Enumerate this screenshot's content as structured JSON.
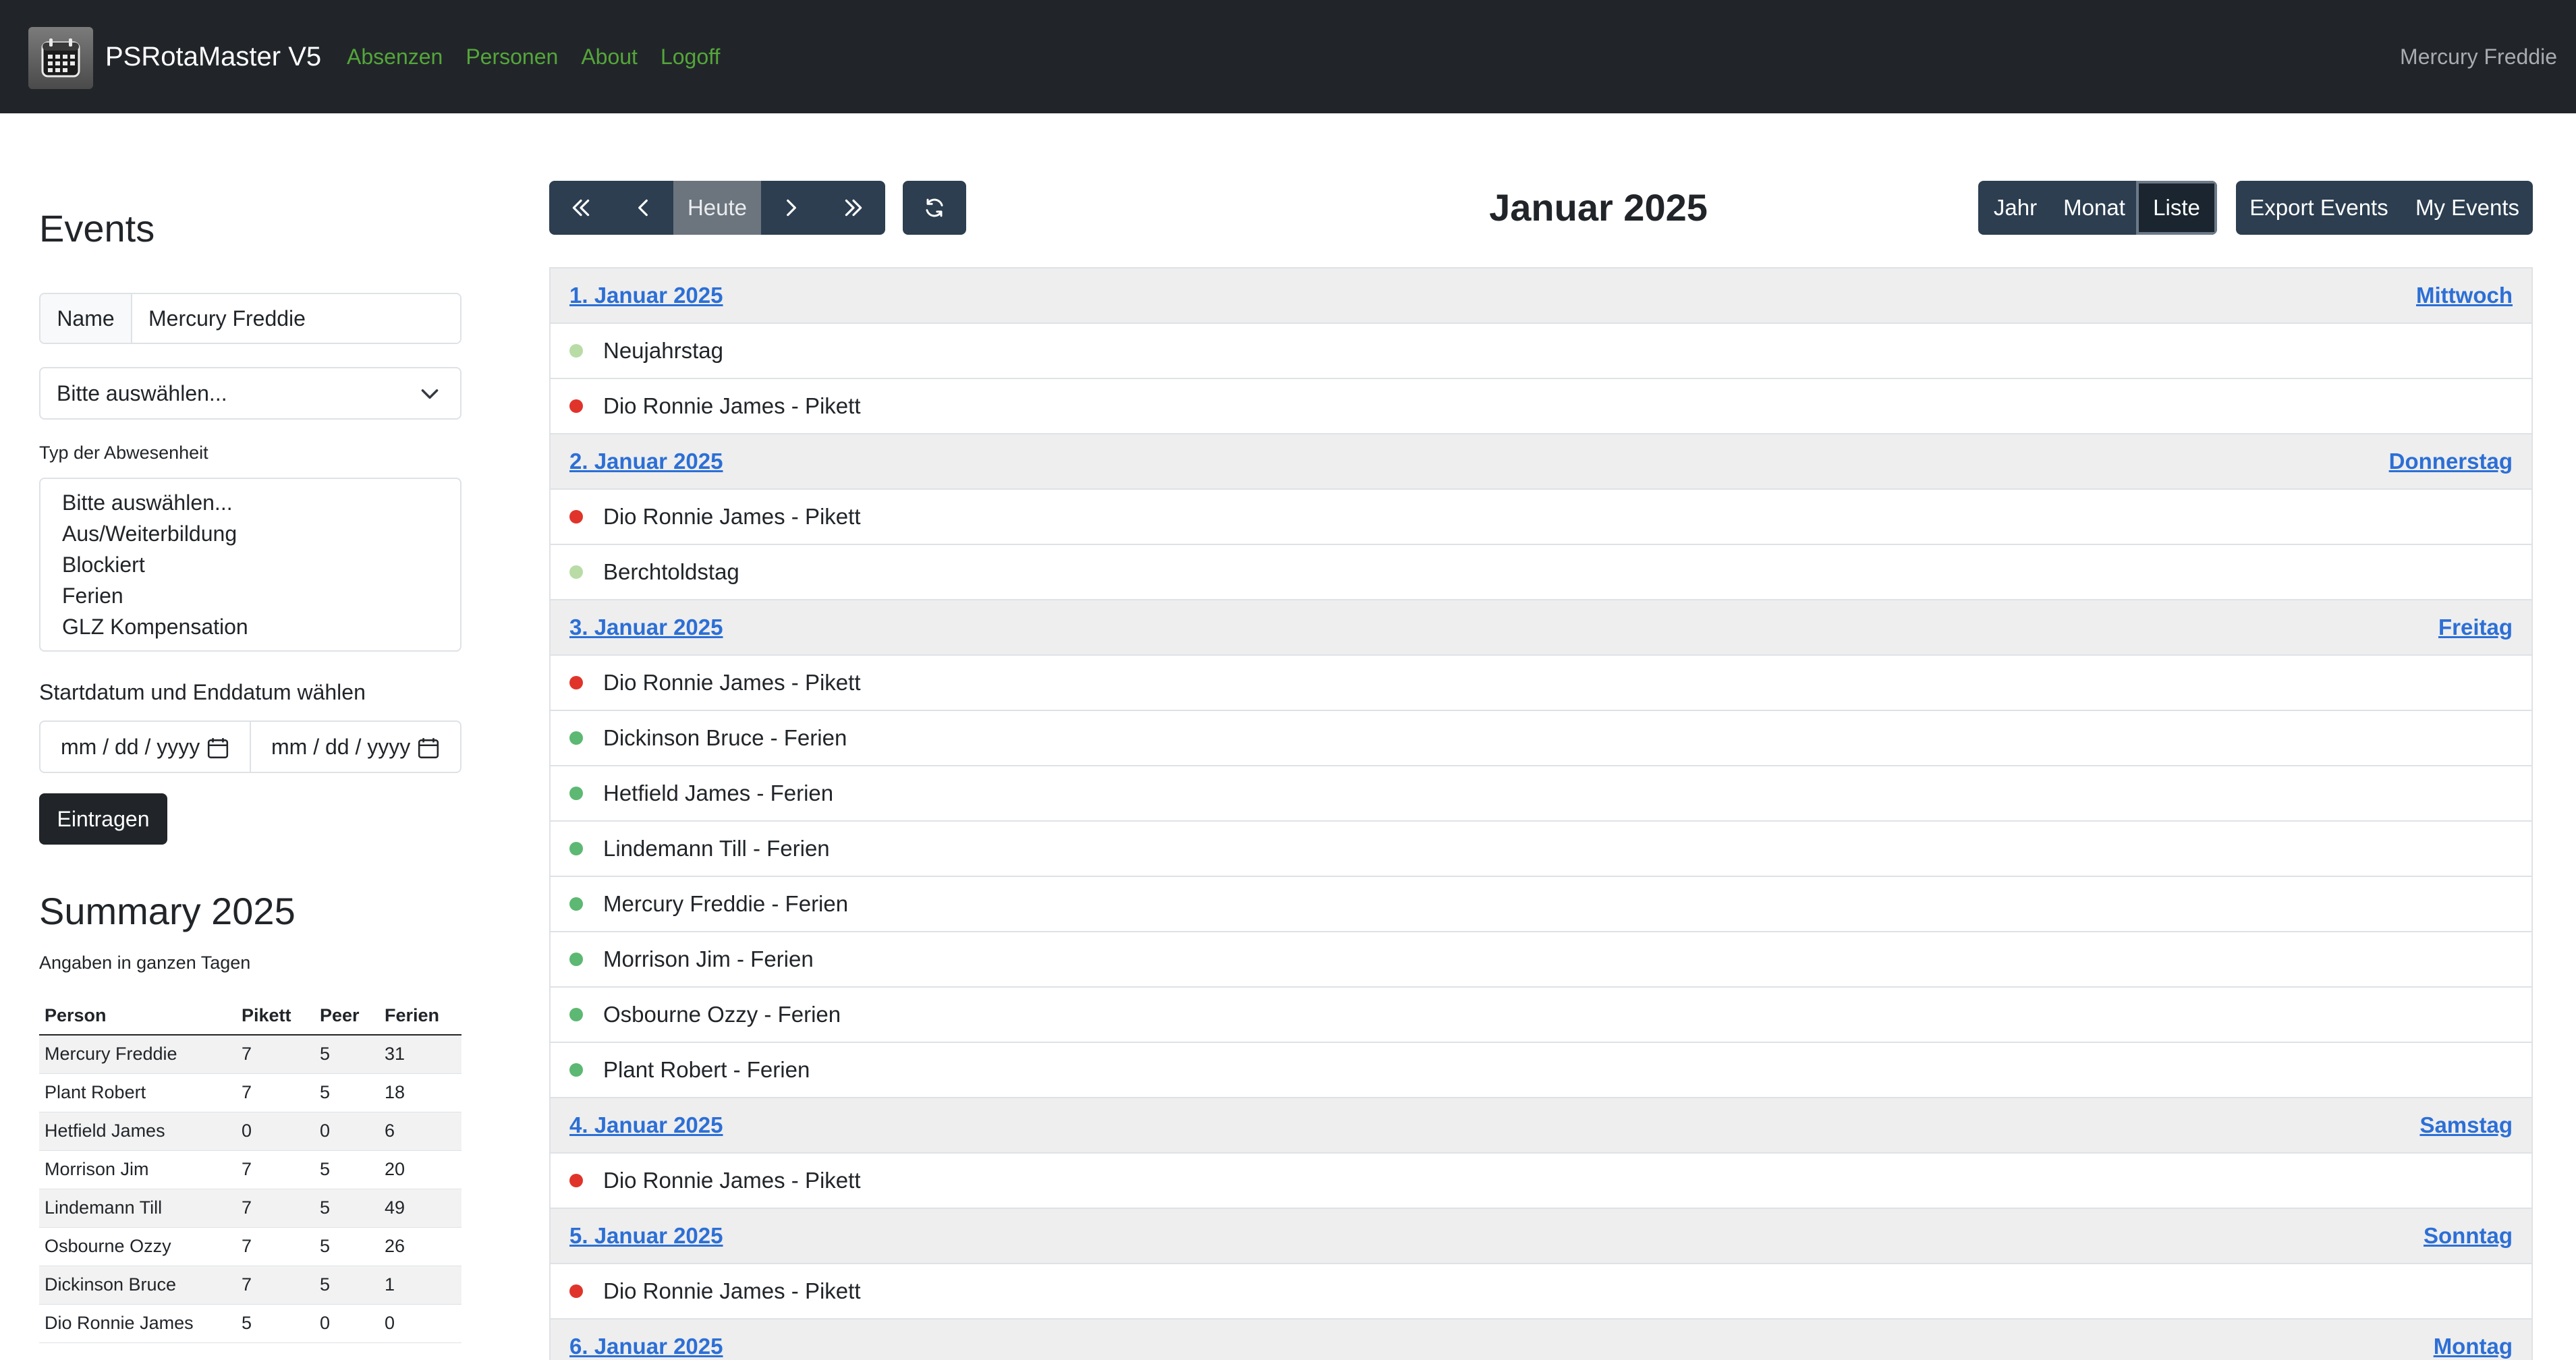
{
  "navbar": {
    "brand": "PSRotaMaster V5",
    "links": [
      "Absenzen",
      "Personen",
      "About",
      "Logoff"
    ],
    "user": "Mercury Freddie"
  },
  "sidebar": {
    "heading": "Events",
    "name_label": "Name",
    "name_value": "Mercury Freddie",
    "select_value": "Bitte auswählen...",
    "type_label": "Typ der Abwesenheit",
    "type_options": [
      "Bitte auswählen...",
      "Aus/Weiterbildung",
      "Blockiert",
      "Ferien",
      "GLZ Kompensation"
    ],
    "date_label": "Startdatum und Enddatum wählen",
    "date_placeholder_start": "mm / dd / yyyy",
    "date_placeholder_end": "mm / dd / yyyy",
    "submit_label": "Eintragen",
    "summary_heading": "Summary 2025",
    "summary_note": "Angaben in ganzen Tagen",
    "summary_headers": [
      "Person",
      "Pikett",
      "Peer",
      "Ferien"
    ],
    "summary_rows": [
      [
        "Mercury Freddie",
        "7",
        "5",
        "31"
      ],
      [
        "Plant Robert",
        "7",
        "5",
        "18"
      ],
      [
        "Hetfield James",
        "0",
        "0",
        "6"
      ],
      [
        "Morrison Jim",
        "7",
        "5",
        "20"
      ],
      [
        "Lindemann Till",
        "7",
        "5",
        "49"
      ],
      [
        "Osbourne Ozzy",
        "7",
        "5",
        "26"
      ],
      [
        "Dickinson Bruce",
        "7",
        "5",
        "1"
      ],
      [
        "Dio Ronnie James",
        "5",
        "0",
        "0"
      ]
    ]
  },
  "toolbar": {
    "today_label": "Heute",
    "title": "Januar 2025",
    "view_year": "Jahr",
    "view_month": "Monat",
    "view_list": "Liste",
    "export_label": "Export Events",
    "my_events_label": "My Events"
  },
  "colors": {
    "holiday": "#b9dca6",
    "pikett": "#e0342b",
    "ferien": "#5cb872"
  },
  "days": [
    {
      "date": "1. Januar 2025",
      "weekday": "Mittwoch",
      "events": [
        {
          "title": "Neujahrstag",
          "color": "#b9dca6"
        },
        {
          "title": "Dio Ronnie James - Pikett",
          "color": "#e0342b"
        }
      ]
    },
    {
      "date": "2. Januar 2025",
      "weekday": "Donnerstag",
      "events": [
        {
          "title": "Dio Ronnie James - Pikett",
          "color": "#e0342b"
        },
        {
          "title": "Berchtoldstag",
          "color": "#b9dca6"
        }
      ]
    },
    {
      "date": "3. Januar 2025",
      "weekday": "Freitag",
      "events": [
        {
          "title": "Dio Ronnie James - Pikett",
          "color": "#e0342b"
        },
        {
          "title": "Dickinson Bruce - Ferien",
          "color": "#5cb872"
        },
        {
          "title": "Hetfield James - Ferien",
          "color": "#5cb872"
        },
        {
          "title": "Lindemann Till - Ferien",
          "color": "#5cb872"
        },
        {
          "title": "Mercury Freddie - Ferien",
          "color": "#5cb872"
        },
        {
          "title": "Morrison Jim - Ferien",
          "color": "#5cb872"
        },
        {
          "title": "Osbourne Ozzy - Ferien",
          "color": "#5cb872"
        },
        {
          "title": "Plant Robert - Ferien",
          "color": "#5cb872"
        }
      ]
    },
    {
      "date": "4. Januar 2025",
      "weekday": "Samstag",
      "events": [
        {
          "title": "Dio Ronnie James - Pikett",
          "color": "#e0342b"
        }
      ]
    },
    {
      "date": "5. Januar 2025",
      "weekday": "Sonntag",
      "events": [
        {
          "title": "Dio Ronnie James - Pikett",
          "color": "#e0342b"
        }
      ]
    },
    {
      "date": "6. Januar 2025",
      "weekday": "Montag",
      "events": []
    }
  ]
}
